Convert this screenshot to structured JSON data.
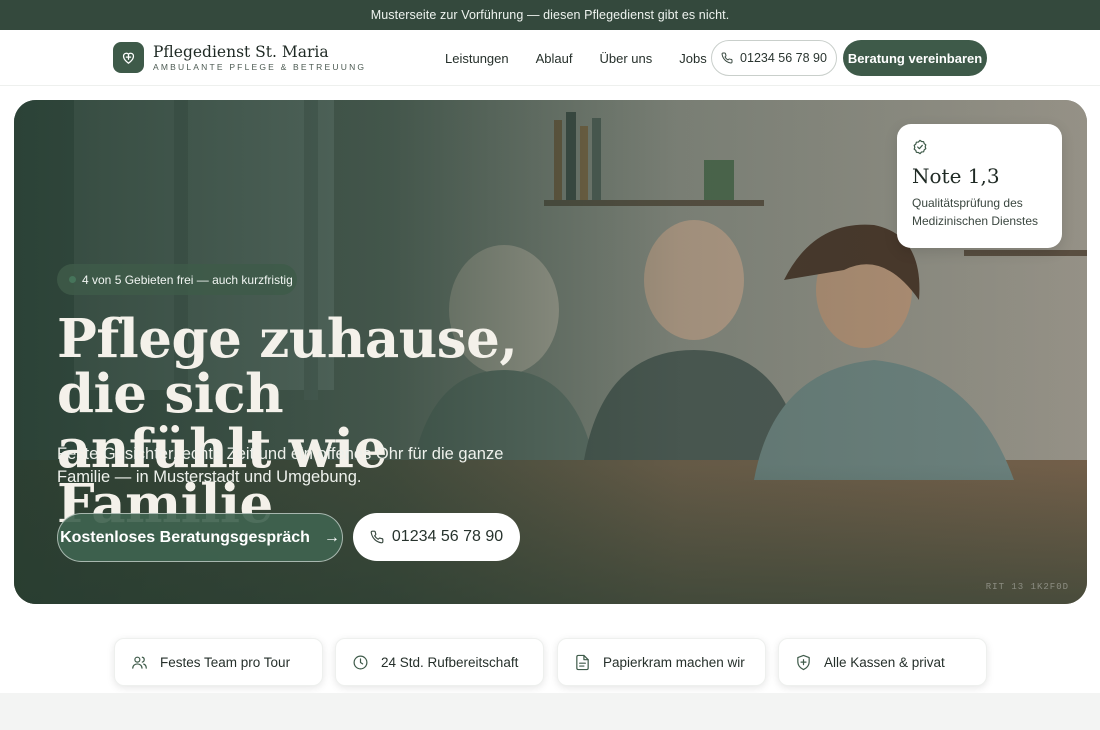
{
  "notice": {
    "text": "Musterseite zur Vorführung — diesen Pflegedienst gibt es nicht."
  },
  "brand": {
    "name": "Pflegedienst St. Maria",
    "tagline": "AMBULANTE PFLEGE & BETREUUNG",
    "logo_icon": "heart-hands-icon"
  },
  "nav": {
    "items": [
      {
        "label": "Leistungen"
      },
      {
        "label": "Ablauf"
      },
      {
        "label": "Über uns"
      },
      {
        "label": "Jobs"
      }
    ],
    "phone_label": "01234 56 78 90",
    "cta_label": "Beratung vereinbaren"
  },
  "hero": {
    "availability": "4 von 5 Gebieten frei — auch kurzfristig",
    "headline_line1": "Pflege zuhause, die sich",
    "headline_line2": "anfühlt wie Familie",
    "lead": "Feste Gesichter, echte Zeit und ein offenes Ohr für die ganze Familie — in Musterstadt und Umgebung.",
    "primary_cta": "Kostenloses Beratungsgespräch",
    "secondary_cta": "01234 56 78 90",
    "rating": {
      "title": "Note 1,3",
      "text": "Qualitätsprüfung des Medizinischen Dienstes",
      "icon": "badge-check-icon"
    },
    "photo_credit": "RIT 13 1K2F0D"
  },
  "features": [
    {
      "label": "Festes Team pro Tour",
      "icon": "users-icon"
    },
    {
      "label": "24 Std. Rufbereitschaft",
      "icon": "clock-icon"
    },
    {
      "label": "Papierkram machen wir",
      "icon": "document-icon"
    },
    {
      "label": "Alle Kassen & privat",
      "icon": "shield-plus-icon"
    }
  ],
  "colors": {
    "brand_green": "#3e5a49",
    "notice_bg": "#34493d",
    "headline_cream": "#f4f1ea"
  }
}
